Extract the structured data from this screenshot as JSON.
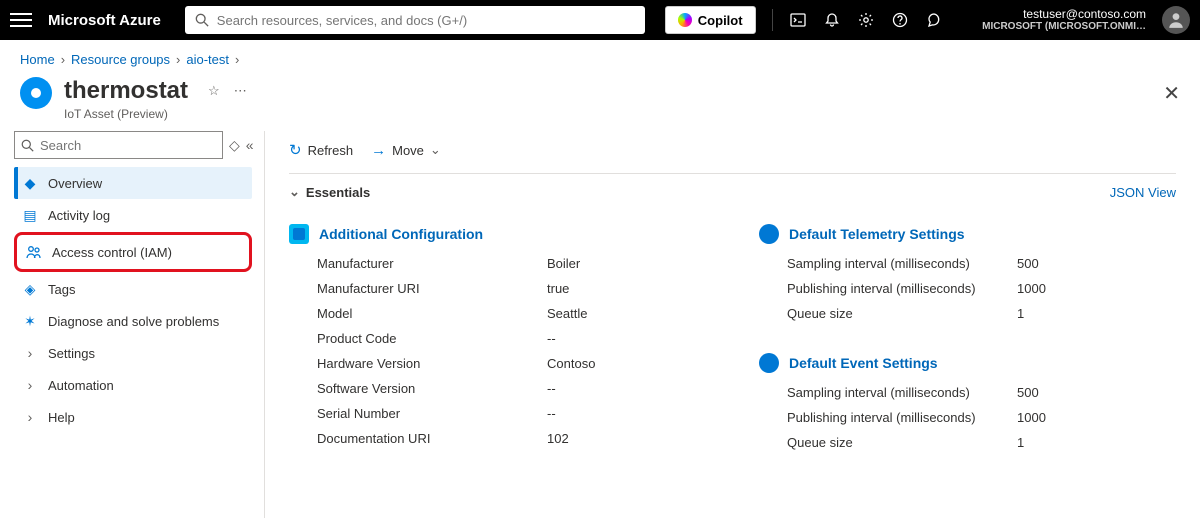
{
  "top": {
    "brand": "Microsoft Azure",
    "search_placeholder": "Search resources, services, and docs (G+/)",
    "copilot": "Copilot",
    "user_email": "testuser@contoso.com",
    "user_tenant": "MICROSOFT (MICROSOFT.ONMI…"
  },
  "breadcrumb": {
    "items": [
      "Home",
      "Resource groups",
      "aio-test"
    ]
  },
  "header": {
    "title": "thermostat",
    "subtitle": "IoT Asset (Preview)"
  },
  "sidebar": {
    "search_placeholder": "Search",
    "items": [
      {
        "label": "Overview"
      },
      {
        "label": "Activity log"
      },
      {
        "label": "Access control (IAM)"
      },
      {
        "label": "Tags"
      },
      {
        "label": "Diagnose and solve problems"
      },
      {
        "label": "Settings"
      },
      {
        "label": "Automation"
      },
      {
        "label": "Help"
      }
    ]
  },
  "cmd": {
    "refresh": "Refresh",
    "move": "Move"
  },
  "essentials_label": "Essentials",
  "json_view": "JSON View",
  "sections": {
    "addcfg_title": "Additional Configuration",
    "addcfg": [
      {
        "k": "Manufacturer",
        "v": "Boiler"
      },
      {
        "k": "Manufacturer URI",
        "v": "true"
      },
      {
        "k": "Model",
        "v": "Seattle"
      },
      {
        "k": "Product Code",
        "v": "--"
      },
      {
        "k": "Hardware Version",
        "v": "Contoso"
      },
      {
        "k": "Software Version",
        "v": "--"
      },
      {
        "k": "Serial Number",
        "v": "--"
      },
      {
        "k": "Documentation URI",
        "v": "102"
      }
    ],
    "telemetry_title": "Default Telemetry Settings",
    "telemetry": [
      {
        "k": "Sampling interval (milliseconds)",
        "v": "500"
      },
      {
        "k": "Publishing interval (milliseconds)",
        "v": "1000"
      },
      {
        "k": "Queue size",
        "v": "1"
      }
    ],
    "event_title": "Default Event Settings",
    "event": [
      {
        "k": "Sampling interval (milliseconds)",
        "v": "500"
      },
      {
        "k": "Publishing interval (milliseconds)",
        "v": "1000"
      },
      {
        "k": "Queue size",
        "v": "1"
      }
    ]
  }
}
